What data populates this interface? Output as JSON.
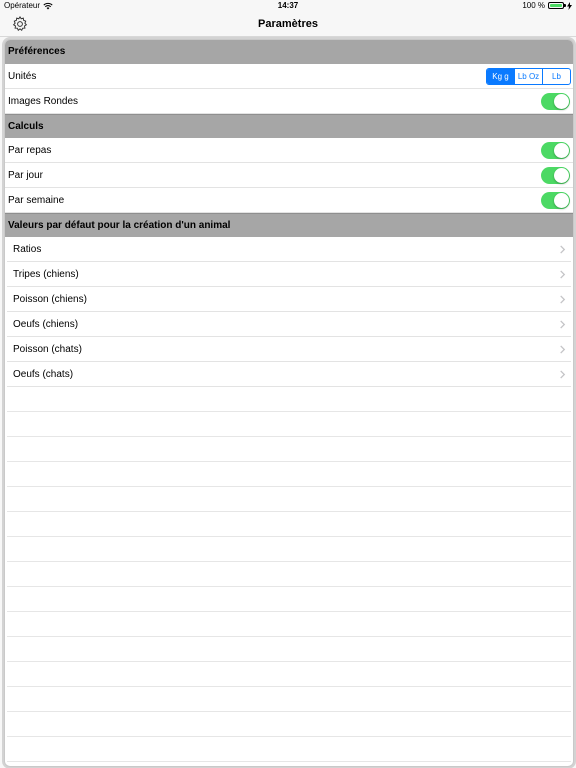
{
  "status_bar": {
    "carrier": "Opérateur",
    "time": "14:37",
    "battery": "100 %"
  },
  "nav": {
    "title": "Paramètres"
  },
  "sections": {
    "preferences": {
      "title": "Préférences",
      "units_label": "Unités",
      "units_options": [
        "Kg g",
        "Lb Oz",
        "Lb"
      ],
      "units_selected": "Kg g",
      "round_images_label": "Images Rondes",
      "round_images_on": true
    },
    "calculs": {
      "title": "Calculs",
      "items": [
        {
          "label": "Par repas",
          "on": true
        },
        {
          "label": "Par jour",
          "on": true
        },
        {
          "label": "Par semaine",
          "on": true
        }
      ]
    },
    "defaults": {
      "title": "Valeurs par défaut pour la création d'un animal",
      "items": [
        "Ratios",
        "Tripes (chiens)",
        "Poisson (chiens)",
        "Oeufs (chiens)",
        "Poisson (chats)",
        "Oeufs (chats)"
      ]
    }
  },
  "colors": {
    "accent": "#0a7aff",
    "toggle_on": "#4cd964",
    "section_header": "#a6a6a6"
  }
}
